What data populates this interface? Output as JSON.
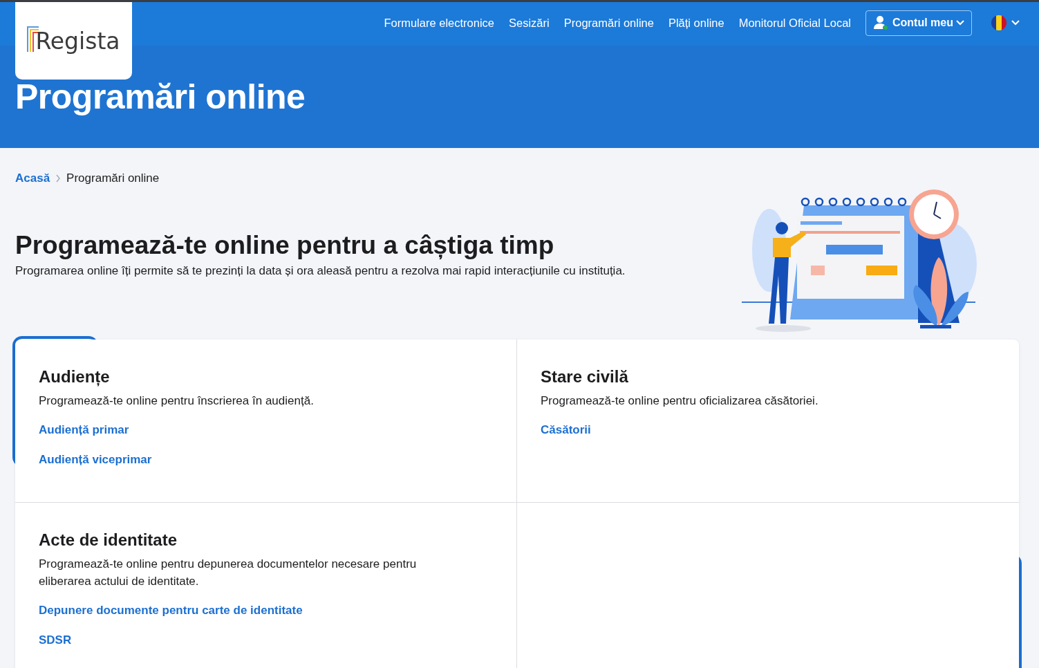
{
  "logo": {
    "text": "Regista"
  },
  "nav": {
    "items": [
      "Formulare electronice",
      "Sesizări",
      "Programări online",
      "Plăți online",
      "Monitorul Oficial Local"
    ],
    "account": {
      "label": "Contul meu",
      "online": true
    }
  },
  "hero": {
    "title": "Programări online"
  },
  "breadcrumb": [
    {
      "label": "Acasă",
      "kind": "link"
    },
    {
      "label": "Programări online",
      "kind": "current"
    }
  ],
  "intro": {
    "heading": "Programează-te online pentru a câștiga timp",
    "text": "Programarea online îți permite să te prezinți la data și ora aleasă pentru a rezolva mai rapid interacțiunile cu instituția."
  },
  "cards": [
    {
      "title": "Audiențe",
      "description": "Programează-te online pentru înscrierea în audiență.",
      "links": [
        "Audiență primar",
        "Audiență viceprimar"
      ]
    },
    {
      "title": "Stare civilă",
      "description": "Programează-te online pentru oficializarea căsătoriei.",
      "links": [
        "Căsătorii"
      ]
    },
    {
      "title": "Acte de identitate",
      "description": "Programează-te online pentru depunerea documentelor necesare pentru eliberarea actului de identitate.",
      "links": [
        "Depunere documente pentru carte de identitate",
        "SDSR"
      ]
    }
  ]
}
